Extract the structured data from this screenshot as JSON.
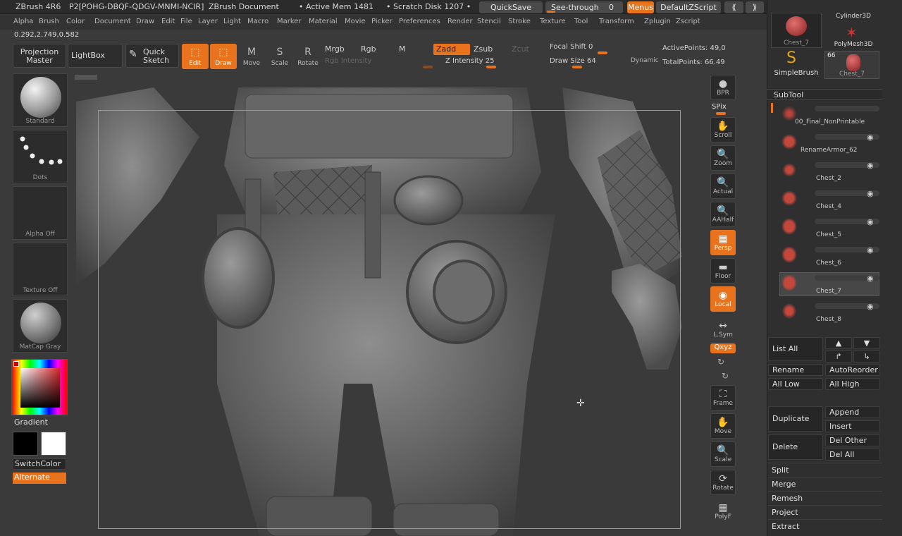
{
  "titlebar": {
    "app": "ZBrush 4R6",
    "serial": "P2[POHG-DBQF-QDGV-MNMI-NCIR]",
    "doc": "ZBrush Document",
    "active_mem": "• Active Mem 1481",
    "scratch": "• Scratch Disk 1207 •",
    "quicksave": "QuickSave",
    "seethrough": "See-through",
    "seethrough_val": "0",
    "menus": "Menus",
    "defaultzscript": "DefaultZScript"
  },
  "menubar": [
    "Alpha",
    "Brush",
    "Color",
    "Document",
    "Draw",
    "Edit",
    "File",
    "Layer",
    "Light",
    "Macro",
    "Marker",
    "Material",
    "Movie",
    "Picker",
    "Preferences",
    "Render",
    "Stencil",
    "Stroke",
    "Texture",
    "Tool",
    "Transform",
    "Zplugin",
    "Zscript"
  ],
  "coords": "0.292,2.749,0.582",
  "toolbar": {
    "projection_master": "Projection Master",
    "lightbox": "LightBox",
    "quick_sketch": "Quick Sketch",
    "edit": "Edit",
    "draw": "Draw",
    "move": "Move",
    "scale": "Scale",
    "rotate": "Rotate",
    "mrgb": "Mrgb",
    "rgb": "Rgb",
    "m": "M",
    "zadd": "Zadd",
    "zsub": "Zsub",
    "zcut": "Zcut",
    "rgb_intensity": "Rgb Intensity",
    "z_intensity": "Z Intensity 25",
    "focal_shift": "Focal Shift",
    "focal_shift_val": "0",
    "draw_size": "Draw Size",
    "draw_size_val": "64",
    "dynamic": "Dynamic",
    "active_points": "ActivePoints: 49,0",
    "total_points": "TotalPoints: 66.49"
  },
  "left_shelf": {
    "brush": "Standard",
    "stroke": "Dots",
    "alpha": "Alpha Off",
    "texture": "Texture Off",
    "material": "MatCap Gray",
    "gradient": "Gradient",
    "switchcolor": "SwitchColor",
    "alternate": "Alternate"
  },
  "right_shelf": {
    "bpr": "BPR",
    "spix": "SPix",
    "scroll": "Scroll",
    "zoom": "Zoom",
    "actual": "Actual",
    "aahalf": "AAHalf",
    "persp": "Persp",
    "floor": "Floor",
    "local": "Local",
    "lsym": "L.Sym",
    "xyz": "Qxyz",
    "frame": "Frame",
    "move": "Move",
    "scale": "Scale",
    "rotate": "Rotate",
    "polyf": "PolyF"
  },
  "tool_palette": {
    "thumb1_label": "Chest_7",
    "thumb2_label": "Cylinder3D",
    "thumb3_label": "PolyMesh3D",
    "thumb4_label": "SimpleBrush",
    "thumb5_label": "Chest_7",
    "thumb5_count": "66"
  },
  "subtool": {
    "header": "SubTool",
    "items": [
      "00_Final_NonPrintable",
      "RenameArmor_62",
      "Chest_2",
      "Chest_4",
      "Chest_5",
      "Chest_6",
      "Chest_7",
      "Chest_8"
    ]
  },
  "subtool_buttons": {
    "list_all": "List All",
    "rename": "Rename",
    "autoreorder": "AutoReorder",
    "all_low": "All Low",
    "all_high": "All High",
    "duplicate": "Duplicate",
    "append": "Append",
    "insert": "Insert",
    "delete": "Delete",
    "del_other": "Del Other",
    "del_all": "Del All",
    "split": "Split",
    "merge": "Merge",
    "remesh": "Remesh",
    "project": "Project",
    "extract": "Extract"
  },
  "colors": {
    "accent": "#e8731c",
    "panel": "#2f2f2f",
    "bg": "#3a3a3a"
  }
}
